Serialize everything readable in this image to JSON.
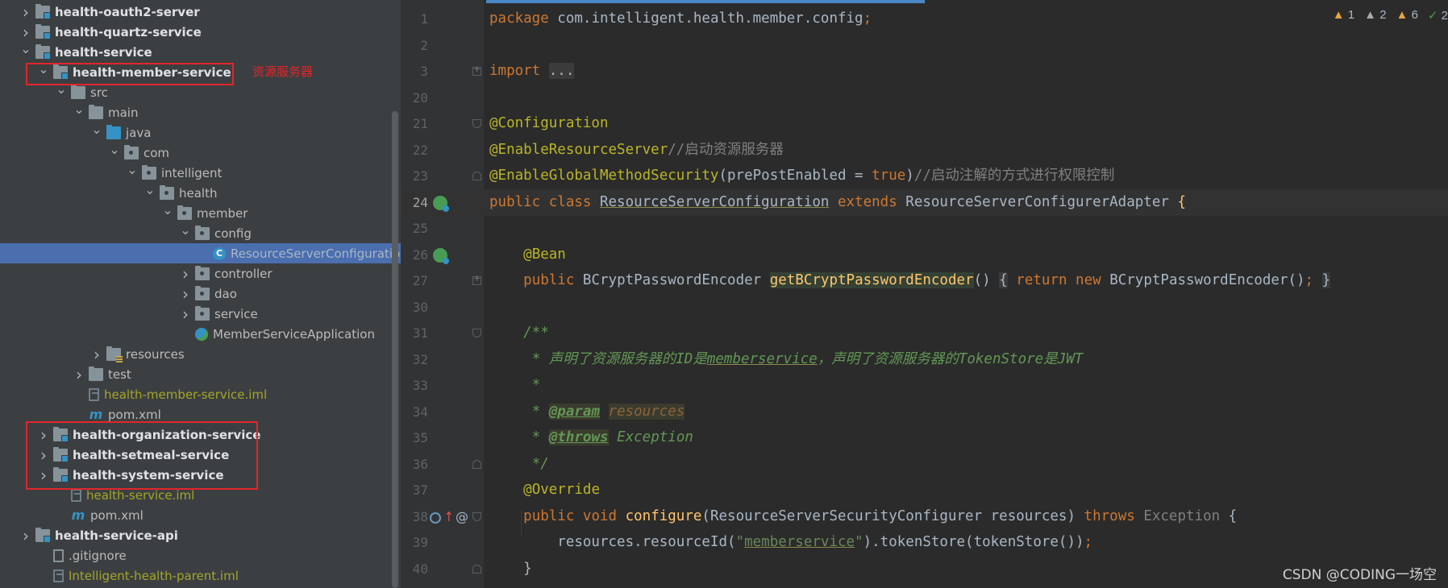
{
  "tree": {
    "items": [
      {
        "label": "health-oauth2-server",
        "depth": 1,
        "chevron": "right",
        "icon": "module-folder-icon",
        "style": "bold"
      },
      {
        "label": "health-quartz-service",
        "depth": 1,
        "chevron": "right",
        "icon": "module-folder-icon",
        "style": "bold"
      },
      {
        "label": "health-service",
        "depth": 1,
        "chevron": "down",
        "icon": "module-folder-icon",
        "style": "bold"
      },
      {
        "label": "health-member-service",
        "depth": 2,
        "chevron": "down",
        "icon": "module-folder-icon",
        "style": "bold"
      },
      {
        "label": "src",
        "depth": 3,
        "chevron": "down",
        "icon": "folder-icon",
        "style": "normal"
      },
      {
        "label": "main",
        "depth": 4,
        "chevron": "down",
        "icon": "folder-icon",
        "style": "normal"
      },
      {
        "label": "java",
        "depth": 5,
        "chevron": "down",
        "icon": "source-folder-icon",
        "style": "normal"
      },
      {
        "label": "com",
        "depth": 6,
        "chevron": "down",
        "icon": "package-icon",
        "style": "normal"
      },
      {
        "label": "intelligent",
        "depth": 7,
        "chevron": "down",
        "icon": "package-icon",
        "style": "normal"
      },
      {
        "label": "health",
        "depth": 8,
        "chevron": "down",
        "icon": "package-icon",
        "style": "normal"
      },
      {
        "label": "member",
        "depth": 9,
        "chevron": "down",
        "icon": "package-icon",
        "style": "normal"
      },
      {
        "label": "config",
        "depth": 10,
        "chevron": "down",
        "icon": "package-icon",
        "style": "normal"
      },
      {
        "label": "ResourceServerConfiguration",
        "depth": 11,
        "chevron": "none",
        "icon": "class-icon",
        "style": "selected"
      },
      {
        "label": "controller",
        "depth": 10,
        "chevron": "right",
        "icon": "package-icon",
        "style": "normal"
      },
      {
        "label": "dao",
        "depth": 10,
        "chevron": "right",
        "icon": "package-icon",
        "style": "normal"
      },
      {
        "label": "service",
        "depth": 10,
        "chevron": "right",
        "icon": "package-icon",
        "style": "normal"
      },
      {
        "label": "MemberServiceApplication",
        "depth": 10,
        "chevron": "none",
        "icon": "spring-class-icon",
        "style": "normal"
      },
      {
        "label": "resources",
        "depth": 5,
        "chevron": "right",
        "icon": "resources-folder-icon",
        "style": "normal"
      },
      {
        "label": "test",
        "depth": 4,
        "chevron": "right",
        "icon": "folder-icon",
        "style": "normal"
      },
      {
        "label": "health-member-service.iml",
        "depth": 4,
        "chevron": "none",
        "icon": "iml-file-icon",
        "style": "olive"
      },
      {
        "label": "pom.xml",
        "depth": 4,
        "chevron": "none",
        "icon": "maven-icon",
        "style": "normal"
      },
      {
        "label": "health-organization-service",
        "depth": 2,
        "chevron": "right",
        "icon": "module-folder-icon",
        "style": "bold"
      },
      {
        "label": "health-setmeal-service",
        "depth": 2,
        "chevron": "right",
        "icon": "module-folder-icon",
        "style": "bold"
      },
      {
        "label": "health-system-service",
        "depth": 2,
        "chevron": "right",
        "icon": "module-folder-icon",
        "style": "bold"
      },
      {
        "label": "health-service.iml",
        "depth": 3,
        "chevron": "none",
        "icon": "iml-file-icon",
        "style": "olive"
      },
      {
        "label": "pom.xml",
        "depth": 3,
        "chevron": "none",
        "icon": "maven-icon",
        "style": "normal"
      },
      {
        "label": "health-service-api",
        "depth": 1,
        "chevron": "right",
        "icon": "module-folder-icon",
        "style": "bold"
      },
      {
        "label": ".gitignore",
        "depth": 2,
        "chevron": "none",
        "icon": "file-icon",
        "style": "normal"
      },
      {
        "label": "Intelligent-health-parent.iml",
        "depth": 2,
        "chevron": "none",
        "icon": "iml-file-icon",
        "style": "olive"
      }
    ],
    "annotation": "资源服务器"
  },
  "editor": {
    "inspections": {
      "warnings_a": "1",
      "warnings_b": "2",
      "warnings_c": "6",
      "ok": "2"
    },
    "lines": [
      {
        "num": "1",
        "tokens": [
          [
            "kw",
            "package "
          ],
          [
            "txt",
            "com.intelligent.health.member.config"
          ],
          [
            "kw",
            ";"
          ]
        ]
      },
      {
        "num": "2",
        "tokens": []
      },
      {
        "num": "3",
        "fold": "plus",
        "tokens": [
          [
            "kw",
            "import "
          ],
          [
            "foldbox",
            "..."
          ]
        ]
      },
      {
        "num": "20",
        "tokens": []
      },
      {
        "num": "21",
        "fold": "open",
        "tokens": [
          [
            "ann",
            "@Configuration"
          ]
        ]
      },
      {
        "num": "22",
        "tokens": [
          [
            "ann",
            "@EnableResourceServer"
          ],
          [
            "cm",
            "//启动资源服务器"
          ]
        ]
      },
      {
        "num": "23",
        "fold": "close",
        "tokens": [
          [
            "ann",
            "@EnableGlobalMethodSecurity"
          ],
          [
            "txt",
            "(prePostEnabled = "
          ],
          [
            "kw",
            "true"
          ],
          [
            "txt",
            ")"
          ],
          [
            "cm",
            "//启动注解的方式进行权限控制"
          ]
        ]
      },
      {
        "num": "24",
        "gutter": "bean",
        "caret": true,
        "tokens": [
          [
            "kw",
            "public class "
          ],
          [
            "underl",
            "ResourceServerConfiguration"
          ],
          [
            "kw",
            " extends "
          ],
          [
            "txt",
            "ResourceServerConfigurerAdapter "
          ],
          [
            "fn",
            "{"
          ]
        ]
      },
      {
        "num": "25",
        "tokens": []
      },
      {
        "num": "26",
        "gutter": "bean",
        "tokens": [
          [
            "txt",
            "    "
          ],
          [
            "ann",
            "@Bean"
          ]
        ]
      },
      {
        "num": "27",
        "fold": "plus",
        "tokens": [
          [
            "txt",
            "    "
          ],
          [
            "kw",
            "public "
          ],
          [
            "txt",
            "BCryptPasswordEncoder "
          ],
          [
            "hlfn",
            "getBCryptPasswordEncoder"
          ],
          [
            "txt",
            "() "
          ],
          [
            "foldbox",
            "{"
          ],
          [
            "txt",
            " "
          ],
          [
            "kw",
            "return new "
          ],
          [
            "txt",
            "BCryptPasswordEncoder()"
          ],
          [
            "kw",
            ";"
          ],
          [
            "txt",
            " "
          ],
          [
            "foldbox",
            "}"
          ]
        ]
      },
      {
        "num": "30",
        "tokens": []
      },
      {
        "num": "31",
        "fold": "open",
        "tokens": [
          [
            "txt",
            "    "
          ],
          [
            "doc",
            "/**"
          ]
        ]
      },
      {
        "num": "32",
        "tokens": [
          [
            "txt",
            "     "
          ],
          [
            "doc",
            "* 声明了资源服务器的ID是"
          ],
          [
            "docu",
            "memberservice"
          ],
          [
            "doc",
            "，声明了资源服务器的TokenStore是JWT"
          ]
        ]
      },
      {
        "num": "33",
        "tokens": [
          [
            "txt",
            "     "
          ],
          [
            "doc",
            "*"
          ]
        ]
      },
      {
        "num": "34",
        "tokens": [
          [
            "txt",
            "     "
          ],
          [
            "doc",
            "* "
          ],
          [
            "doctag",
            "@param"
          ],
          [
            "doc",
            " "
          ],
          [
            "docparam",
            "resources"
          ]
        ]
      },
      {
        "num": "35",
        "tokens": [
          [
            "txt",
            "     "
          ],
          [
            "doc",
            "* "
          ],
          [
            "doctag",
            "@throws"
          ],
          [
            "doc",
            " "
          ],
          [
            "docex",
            "Exception"
          ]
        ]
      },
      {
        "num": "36",
        "fold": "close",
        "tokens": [
          [
            "txt",
            "     "
          ],
          [
            "doc",
            "*/"
          ]
        ]
      },
      {
        "num": "37",
        "tokens": [
          [
            "txt",
            "    "
          ],
          [
            "ann",
            "@Override"
          ]
        ]
      },
      {
        "num": "38",
        "gutter": "override",
        "fold": "open",
        "tokens": [
          [
            "txt",
            "    "
          ],
          [
            "kw",
            "public void "
          ],
          [
            "fn",
            "configure"
          ],
          [
            "txt",
            "(ResourceServerSecurityConfigurer resources) "
          ],
          [
            "kw",
            "throws "
          ],
          [
            "grey",
            "Exception "
          ],
          [
            "txt",
            "{"
          ]
        ]
      },
      {
        "num": "39",
        "tokens": [
          [
            "txt",
            "        resources.resourceId("
          ],
          [
            "str",
            "\""
          ],
          [
            "stru",
            "memberservice"
          ],
          [
            "str",
            "\""
          ],
          [
            "txt",
            ").tokenStore(tokenStore())"
          ],
          [
            "kw",
            ";"
          ]
        ]
      },
      {
        "num": "40",
        "fold": "close",
        "tokens": [
          [
            "txt",
            "    }"
          ]
        ]
      }
    ]
  },
  "watermark": "CSDN @CODING一场空"
}
